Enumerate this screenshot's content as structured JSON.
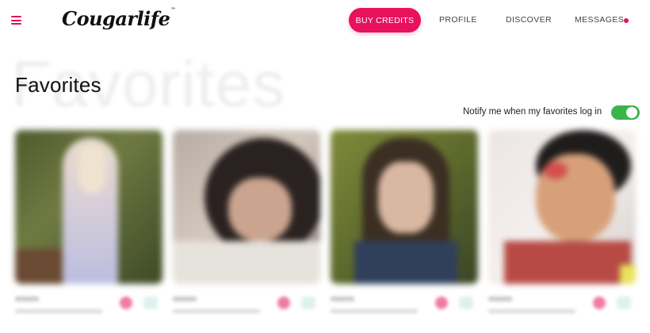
{
  "header": {
    "logo_text": "Cougarlife",
    "logo_tm": "™",
    "buy_credits_label": "BUY CREDITS",
    "nav": {
      "profile": "PROFILE",
      "discover": "DISCOVER",
      "messages": "MESSAGES"
    },
    "accent_color": "#e8115c"
  },
  "page": {
    "ghost_title": "Favorites",
    "title": "Favorites",
    "notify_label": "Notify me when my favorites log in",
    "notify_enabled": true,
    "toggle_color": "#3ab54a"
  },
  "favorites": [
    {
      "photo": "profile-photo-1"
    },
    {
      "photo": "profile-photo-2"
    },
    {
      "photo": "profile-photo-3"
    },
    {
      "photo": "profile-photo-4"
    }
  ]
}
